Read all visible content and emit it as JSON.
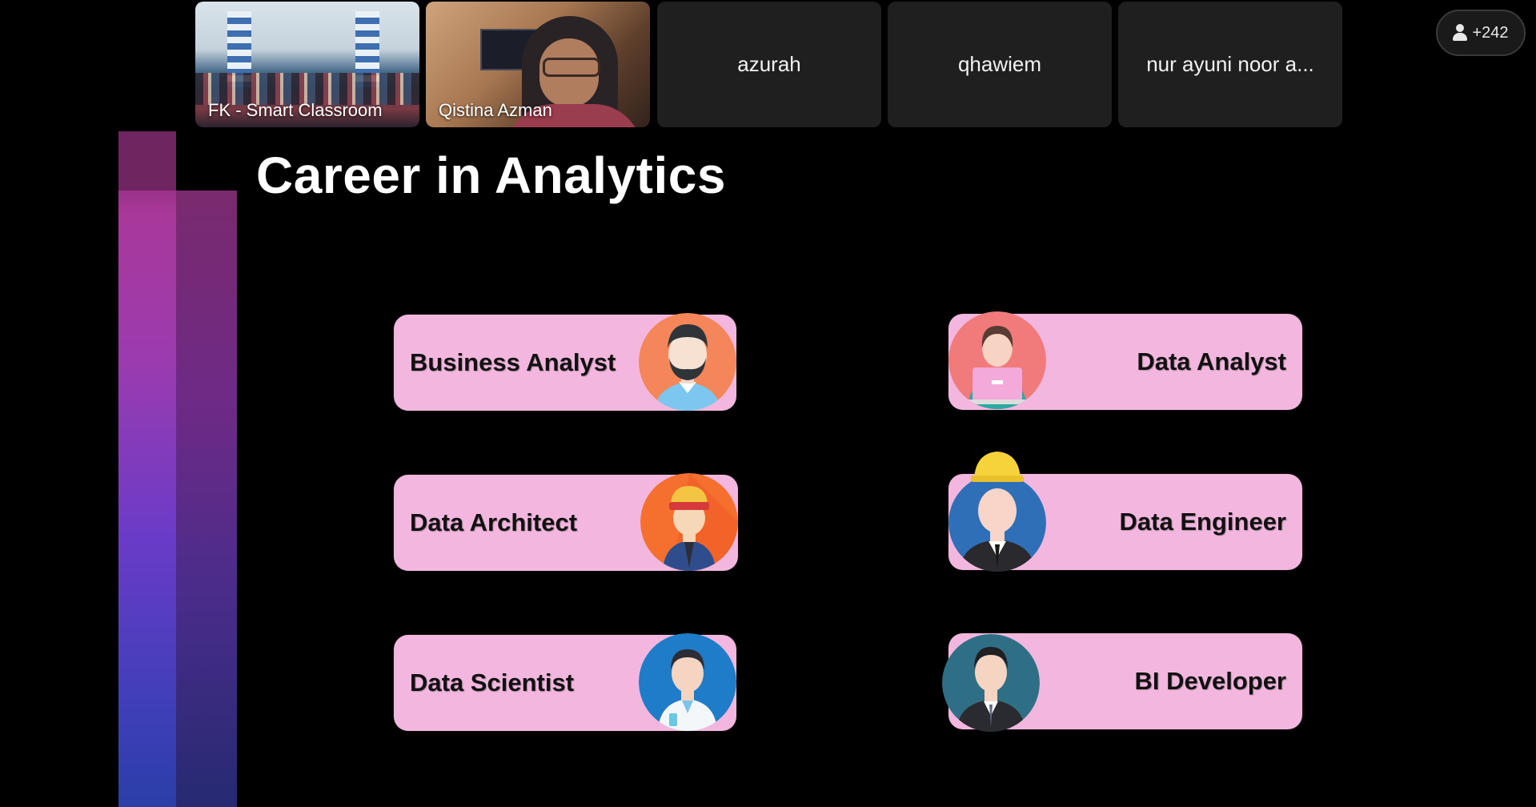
{
  "participants": {
    "video_tiles": [
      {
        "label": "FK - Smart Classroom"
      },
      {
        "label": "Qistina Azman"
      }
    ],
    "name_tiles": [
      {
        "name": "azurah"
      },
      {
        "name": "qhawiem"
      },
      {
        "name": "nur ayuni noor a..."
      }
    ],
    "overflow_count": "+242"
  },
  "slide": {
    "title": "Career in Analytics",
    "careers": [
      {
        "label": "Business Analyst",
        "icon": "business-analyst-avatar-icon"
      },
      {
        "label": "Data Analyst",
        "icon": "data-analyst-avatar-icon"
      },
      {
        "label": "Data Architect",
        "icon": "data-architect-avatar-icon"
      },
      {
        "label": "Data Engineer",
        "icon": "data-engineer-avatar-icon"
      },
      {
        "label": "Data Scientist",
        "icon": "data-scientist-avatar-icon"
      },
      {
        "label": "BI Developer",
        "icon": "bi-developer-avatar-icon"
      }
    ],
    "card_color": "#f3b7df"
  }
}
